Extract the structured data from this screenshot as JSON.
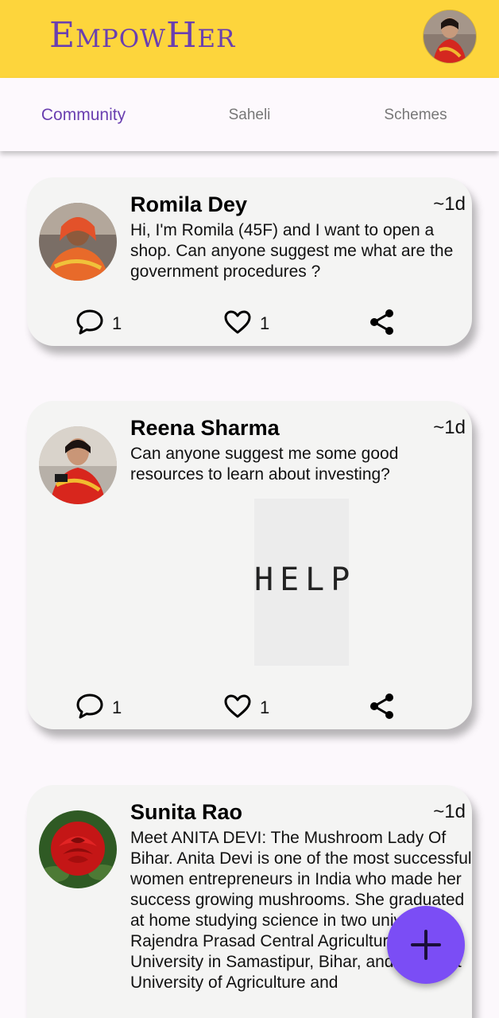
{
  "app": {
    "title": "EmpowHer"
  },
  "tabs": [
    {
      "label": "Community"
    },
    {
      "label": "Saheli"
    },
    {
      "label": "Schemes"
    }
  ],
  "posts": [
    {
      "author": "Romila Dey",
      "time": "~1d",
      "text": "Hi, I'm Romila (45F) and I want to open a shop. Can anyone suggest me what are the government procedures ?",
      "comments": "1",
      "likes": "1"
    },
    {
      "author": "Reena Sharma",
      "time": "~1d",
      "text": "Can anyone suggest me some good resources to learn about investing?",
      "image_text": "HELP",
      "comments": "1",
      "likes": "1"
    },
    {
      "author": "Sunita Rao",
      "time": "~1d",
      "text": "Meet ANITA DEVI: The Mushroom Lady Of Bihar. Anita Devi is one of the most successful women entrepreneurs in India who made her success growing mushrooms. She graduated at home studying science in two universities, Rajendra Prasad Central Agricultural University in Samastipur, Bihar, and GB Pant University of Agriculture and"
    }
  ],
  "icons": {
    "comment": "comment-icon",
    "like": "heart-icon",
    "share": "share-icon",
    "add": "plus-icon"
  },
  "colors": {
    "appbar": "#fdd53c",
    "brand": "#6a3fb0",
    "fab": "#7b4df5",
    "card": "#f4f4f3"
  }
}
